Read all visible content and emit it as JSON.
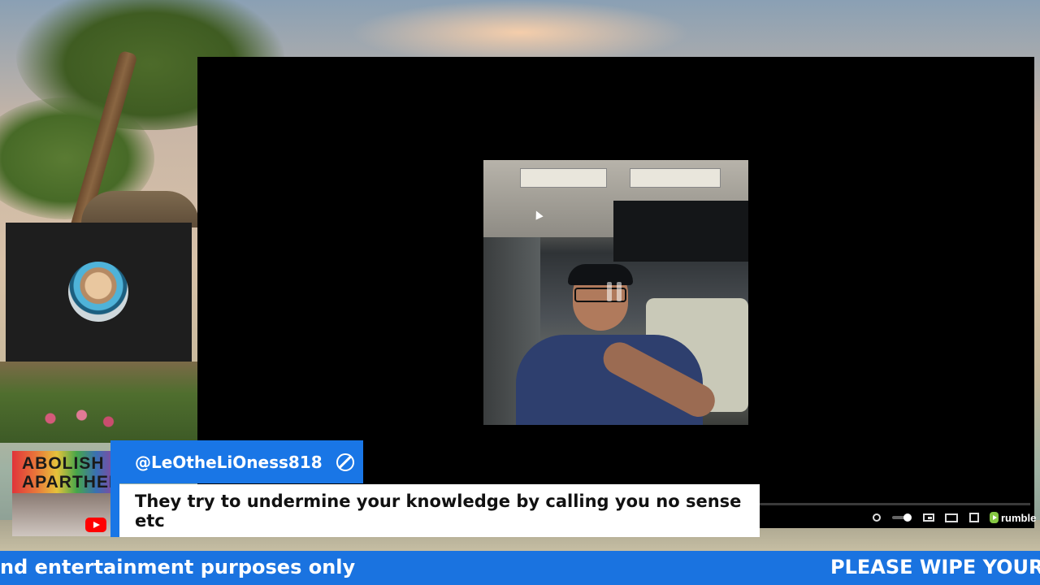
{
  "chat": {
    "username": "@LeOtheLiOness818",
    "message": "They try to undermine your knowledge by calling you no sense etc"
  },
  "ticker": {
    "left_text": "nd entertainment purposes only",
    "right_text": "PLEASE WIPE YOUR"
  },
  "player": {
    "brand": "rumble",
    "icons": [
      "settings-icon",
      "volume-icon",
      "pip-icon",
      "theater-icon",
      "fullscreen-icon",
      "rumble-logo-icon"
    ]
  },
  "thumbnail": {
    "line1": "ABOLISH",
    "line2": "APARTHEID"
  },
  "colors": {
    "chat_blue": "#1976e6",
    "ticker_blue": "#1a73e0",
    "rumble_green": "#85c742",
    "youtube_red": "#ff0000"
  }
}
